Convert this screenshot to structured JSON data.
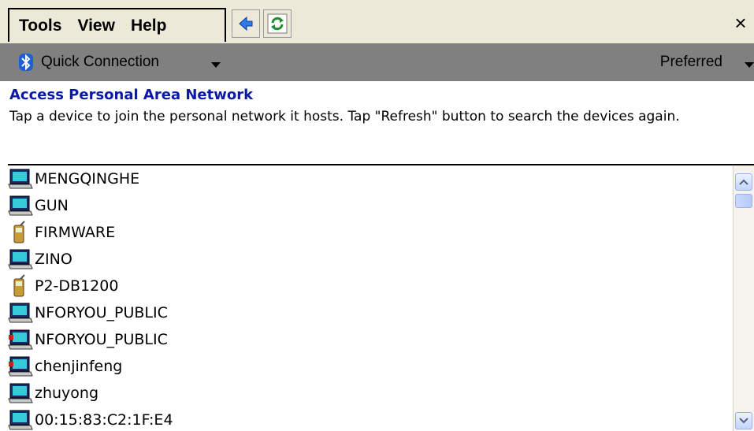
{
  "menubar": {
    "items": [
      {
        "label": "Tools"
      },
      {
        "label": "View"
      },
      {
        "label": "Help"
      }
    ],
    "close_label": "×",
    "icons": [
      "back-arrow-icon",
      "refresh-icon"
    ]
  },
  "connbar": {
    "profile_label": "Quick Connection",
    "preferred_label": "Preferred",
    "icons": [
      "bluetooth-icon",
      "dropdown-arrow-icon"
    ]
  },
  "info": {
    "title": "Access Personal Area Network",
    "description": "Tap a device to join the personal network it hosts. Tap \"Refresh\" button to search the devices again."
  },
  "devices": [
    {
      "name": "MENGQINGHE",
      "icon": "computer-icon"
    },
    {
      "name": "GUN",
      "icon": "computer-icon"
    },
    {
      "name": "FIRMWARE",
      "icon": "phone-icon"
    },
    {
      "name": "ZINO",
      "icon": "computer-icon"
    },
    {
      "name": "P2-DB1200",
      "icon": "phone-icon"
    },
    {
      "name": "NFORYOU_PUBLIC",
      "icon": "computer-icon"
    },
    {
      "name": "NFORYOU_PUBLIC",
      "icon": "computer-connected-icon"
    },
    {
      "name": "chenjinfeng",
      "icon": "computer-connected-icon"
    },
    {
      "name": "zhuyong",
      "icon": "computer-icon"
    },
    {
      "name": "00:15:83:C2:1F:E4",
      "icon": "computer-icon"
    }
  ],
  "colors": {
    "menubar_bg": "#ece9d8",
    "connbar_bg": "#808080",
    "title_blue": "#0b1aa6",
    "bluetooth_blue": "#1f5fd6"
  }
}
